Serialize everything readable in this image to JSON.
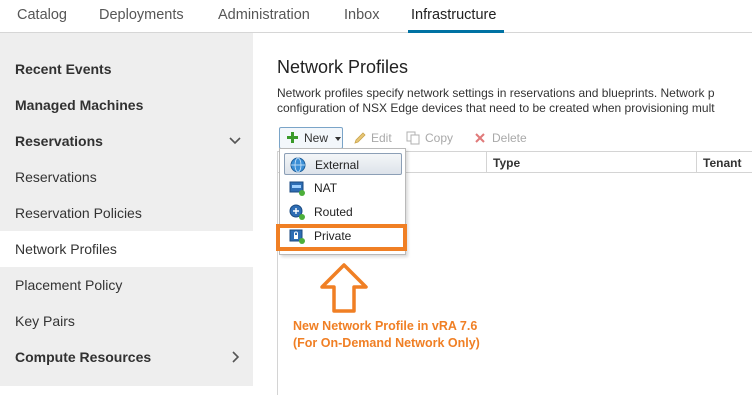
{
  "top_tabs": [
    "Catalog",
    "Deployments",
    "Administration",
    "Inbox",
    "Infrastructure"
  ],
  "active_tab": "Infrastructure",
  "sidebar": {
    "items": [
      {
        "label": "Recent Events",
        "bold": true
      },
      {
        "label": "Managed Machines",
        "bold": true
      },
      {
        "label": "Reservations",
        "bold": true,
        "expander": "chevron-down"
      },
      {
        "label": "Reservations",
        "bold": false
      },
      {
        "label": "Reservation Policies",
        "bold": false
      },
      {
        "label": "Network Profiles",
        "bold": false,
        "selected": true
      },
      {
        "label": "Placement Policy",
        "bold": false
      },
      {
        "label": "Key Pairs",
        "bold": false
      },
      {
        "label": "Compute Resources",
        "bold": true,
        "expander": "chevron-right"
      }
    ]
  },
  "main": {
    "title": "Network Profiles",
    "description_line1": "Network profiles specify network settings in reservations and blueprints. Network p",
    "description_line2": "configuration of NSX Edge devices that need to be created when provisioning mult",
    "toolbar": {
      "new_label": "New",
      "edit_label": "Edit",
      "copy_label": "Copy",
      "delete_label": "Delete"
    },
    "columns": [
      "Type",
      "Tenant"
    ]
  },
  "new_menu": {
    "items": [
      {
        "label": "External",
        "icon": "globe-icon",
        "hovered": true
      },
      {
        "label": "NAT",
        "icon": "nat-icon"
      },
      {
        "label": "Routed",
        "icon": "routed-icon"
      },
      {
        "label": "Private",
        "icon": "private-lock-icon"
      }
    ]
  },
  "annotation": {
    "line1": "New Network Profile in vRA 7.6",
    "line2": "(For On-Demand Network Only)",
    "color": "#f07f24"
  },
  "colors": {
    "accent": "#0072a3",
    "sidebar_bg": "#eeeeee",
    "highlight": "#f07f24"
  }
}
